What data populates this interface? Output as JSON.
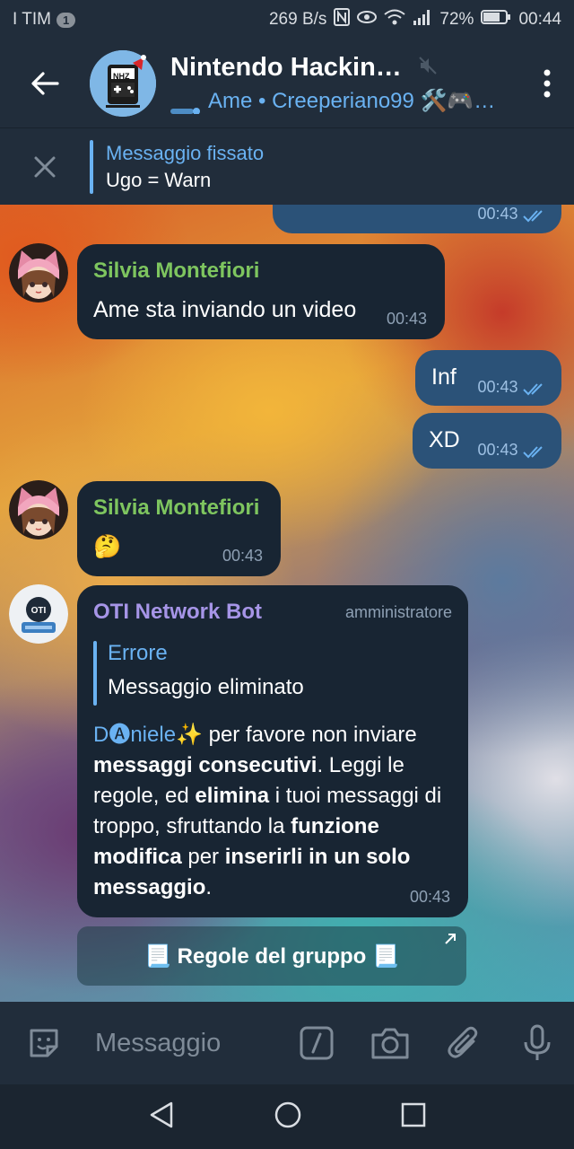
{
  "status_bar": {
    "carrier": "I TIM",
    "notification_count": "1",
    "net_speed": "269 B/s",
    "battery": "72%",
    "time": "00:44"
  },
  "header": {
    "title": "Nintendo Hackin…",
    "avatar_label": "NHZ",
    "subtitle": "Ame • Creeperiano99 🛠️🎮…"
  },
  "pinned": {
    "title": "Messaggio fissato",
    "text": "Ugo = Warn"
  },
  "messages": [
    {
      "time": "00:43"
    },
    {
      "sender": "Silvia Montefiori",
      "text": "Ame sta inviando un video",
      "time": "00:43"
    },
    {
      "text": "Inf",
      "time": "00:43"
    },
    {
      "text": "XD",
      "time": "00:43"
    },
    {
      "sender": "Silvia Montefiori",
      "text": "🤔",
      "time": "00:43"
    },
    {
      "sender": "OTI Network Bot",
      "role": "amministratore",
      "quote_title": "Errore",
      "quote_text": "Messaggio eliminato",
      "mention": "D🅐niele✨",
      "body": [
        " per favore non inviare ",
        "messaggi consecutivi",
        ". Leggi le regole, ed ",
        "elimina",
        " i tuoi messaggi di troppo, sfruttando la ",
        "funzione modifica",
        " per ",
        "inserirli in un solo messaggio",
        "."
      ],
      "time": "00:43"
    }
  ],
  "keyboard_button": "📃 Regole del gruppo 📃",
  "input": {
    "placeholder": "Messaggio"
  },
  "colors": {
    "accent": "#6ab2f2",
    "green_name": "#7ec55f",
    "purple_name": "#a695e7"
  }
}
